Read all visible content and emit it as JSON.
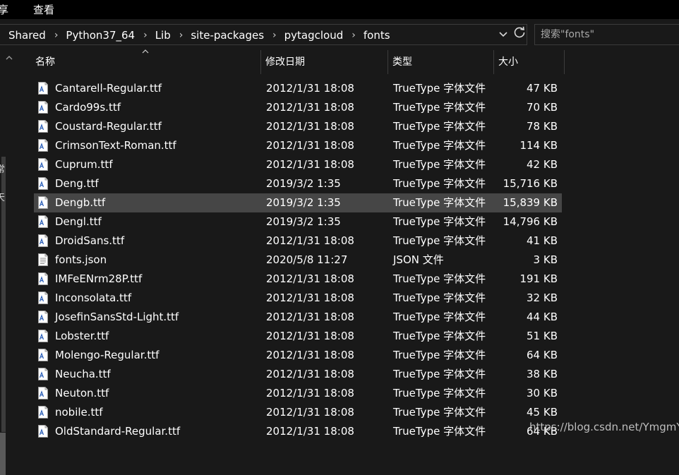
{
  "ribbon": {
    "tabs": [
      "享",
      "查看"
    ]
  },
  "address": {
    "crumbs": [
      "Shared",
      "Python37_64",
      "Lib",
      "site-packages",
      "pytagcloud",
      "fonts"
    ],
    "separator": "›",
    "dropdown_icon": "chevron-down-icon",
    "refresh_icon": "refresh-icon"
  },
  "search": {
    "placeholder": "搜索\"fonts\""
  },
  "columns": {
    "name": "名称",
    "date": "修改日期",
    "type": "类型",
    "size": "大小"
  },
  "nav": {
    "clip1": "常",
    "clip2": "天"
  },
  "files": [
    {
      "name": "Cantarell-Regular.ttf",
      "date": "2012/1/31 18:08",
      "type": "TrueType 字体文件",
      "size": "47 KB",
      "icon": "font-file-icon"
    },
    {
      "name": "Cardo99s.ttf",
      "date": "2012/1/31 18:08",
      "type": "TrueType 字体文件",
      "size": "70 KB",
      "icon": "font-file-icon"
    },
    {
      "name": "Coustard-Regular.ttf",
      "date": "2012/1/31 18:08",
      "type": "TrueType 字体文件",
      "size": "78 KB",
      "icon": "font-file-icon"
    },
    {
      "name": "CrimsonText-Roman.ttf",
      "date": "2012/1/31 18:08",
      "type": "TrueType 字体文件",
      "size": "114 KB",
      "icon": "font-file-icon"
    },
    {
      "name": "Cuprum.ttf",
      "date": "2012/1/31 18:08",
      "type": "TrueType 字体文件",
      "size": "42 KB",
      "icon": "font-file-icon"
    },
    {
      "name": "Deng.ttf",
      "date": "2019/3/2 1:35",
      "type": "TrueType 字体文件",
      "size": "15,716 KB",
      "icon": "font-file-icon"
    },
    {
      "name": "Dengb.ttf",
      "date": "2019/3/2 1:35",
      "type": "TrueType 字体文件",
      "size": "15,839 KB",
      "icon": "font-file-icon",
      "selected": true
    },
    {
      "name": "Dengl.ttf",
      "date": "2019/3/2 1:35",
      "type": "TrueType 字体文件",
      "size": "14,796 KB",
      "icon": "font-file-icon"
    },
    {
      "name": "DroidSans.ttf",
      "date": "2012/1/31 18:08",
      "type": "TrueType 字体文件",
      "size": "41 KB",
      "icon": "font-file-icon"
    },
    {
      "name": "fonts.json",
      "date": "2020/5/8 11:27",
      "type": "JSON 文件",
      "size": "3 KB",
      "icon": "text-file-icon"
    },
    {
      "name": "IMFeENrm28P.ttf",
      "date": "2012/1/31 18:08",
      "type": "TrueType 字体文件",
      "size": "191 KB",
      "icon": "font-file-icon"
    },
    {
      "name": "Inconsolata.ttf",
      "date": "2012/1/31 18:08",
      "type": "TrueType 字体文件",
      "size": "32 KB",
      "icon": "font-file-icon"
    },
    {
      "name": "JosefinSansStd-Light.ttf",
      "date": "2012/1/31 18:08",
      "type": "TrueType 字体文件",
      "size": "44 KB",
      "icon": "font-file-icon"
    },
    {
      "name": "Lobster.ttf",
      "date": "2012/1/31 18:08",
      "type": "TrueType 字体文件",
      "size": "51 KB",
      "icon": "font-file-icon"
    },
    {
      "name": "Molengo-Regular.ttf",
      "date": "2012/1/31 18:08",
      "type": "TrueType 字体文件",
      "size": "64 KB",
      "icon": "font-file-icon"
    },
    {
      "name": "Neucha.ttf",
      "date": "2012/1/31 18:08",
      "type": "TrueType 字体文件",
      "size": "38 KB",
      "icon": "font-file-icon"
    },
    {
      "name": "Neuton.ttf",
      "date": "2012/1/31 18:08",
      "type": "TrueType 字体文件",
      "size": "30 KB",
      "icon": "font-file-icon"
    },
    {
      "name": "nobile.ttf",
      "date": "2012/1/31 18:08",
      "type": "TrueType 字体文件",
      "size": "45 KB",
      "icon": "font-file-icon"
    },
    {
      "name": "OldStandard-Regular.ttf",
      "date": "2012/1/31 18:08",
      "type": "TrueType 字体文件",
      "size": "64 KB",
      "icon": "font-file-icon"
    }
  ],
  "watermark": "https://blog.csdn.net/YmgmY",
  "colors": {
    "background": "#191919",
    "selected_row": "#464646",
    "text": "#ffffff",
    "border": "#3b3b3b"
  }
}
